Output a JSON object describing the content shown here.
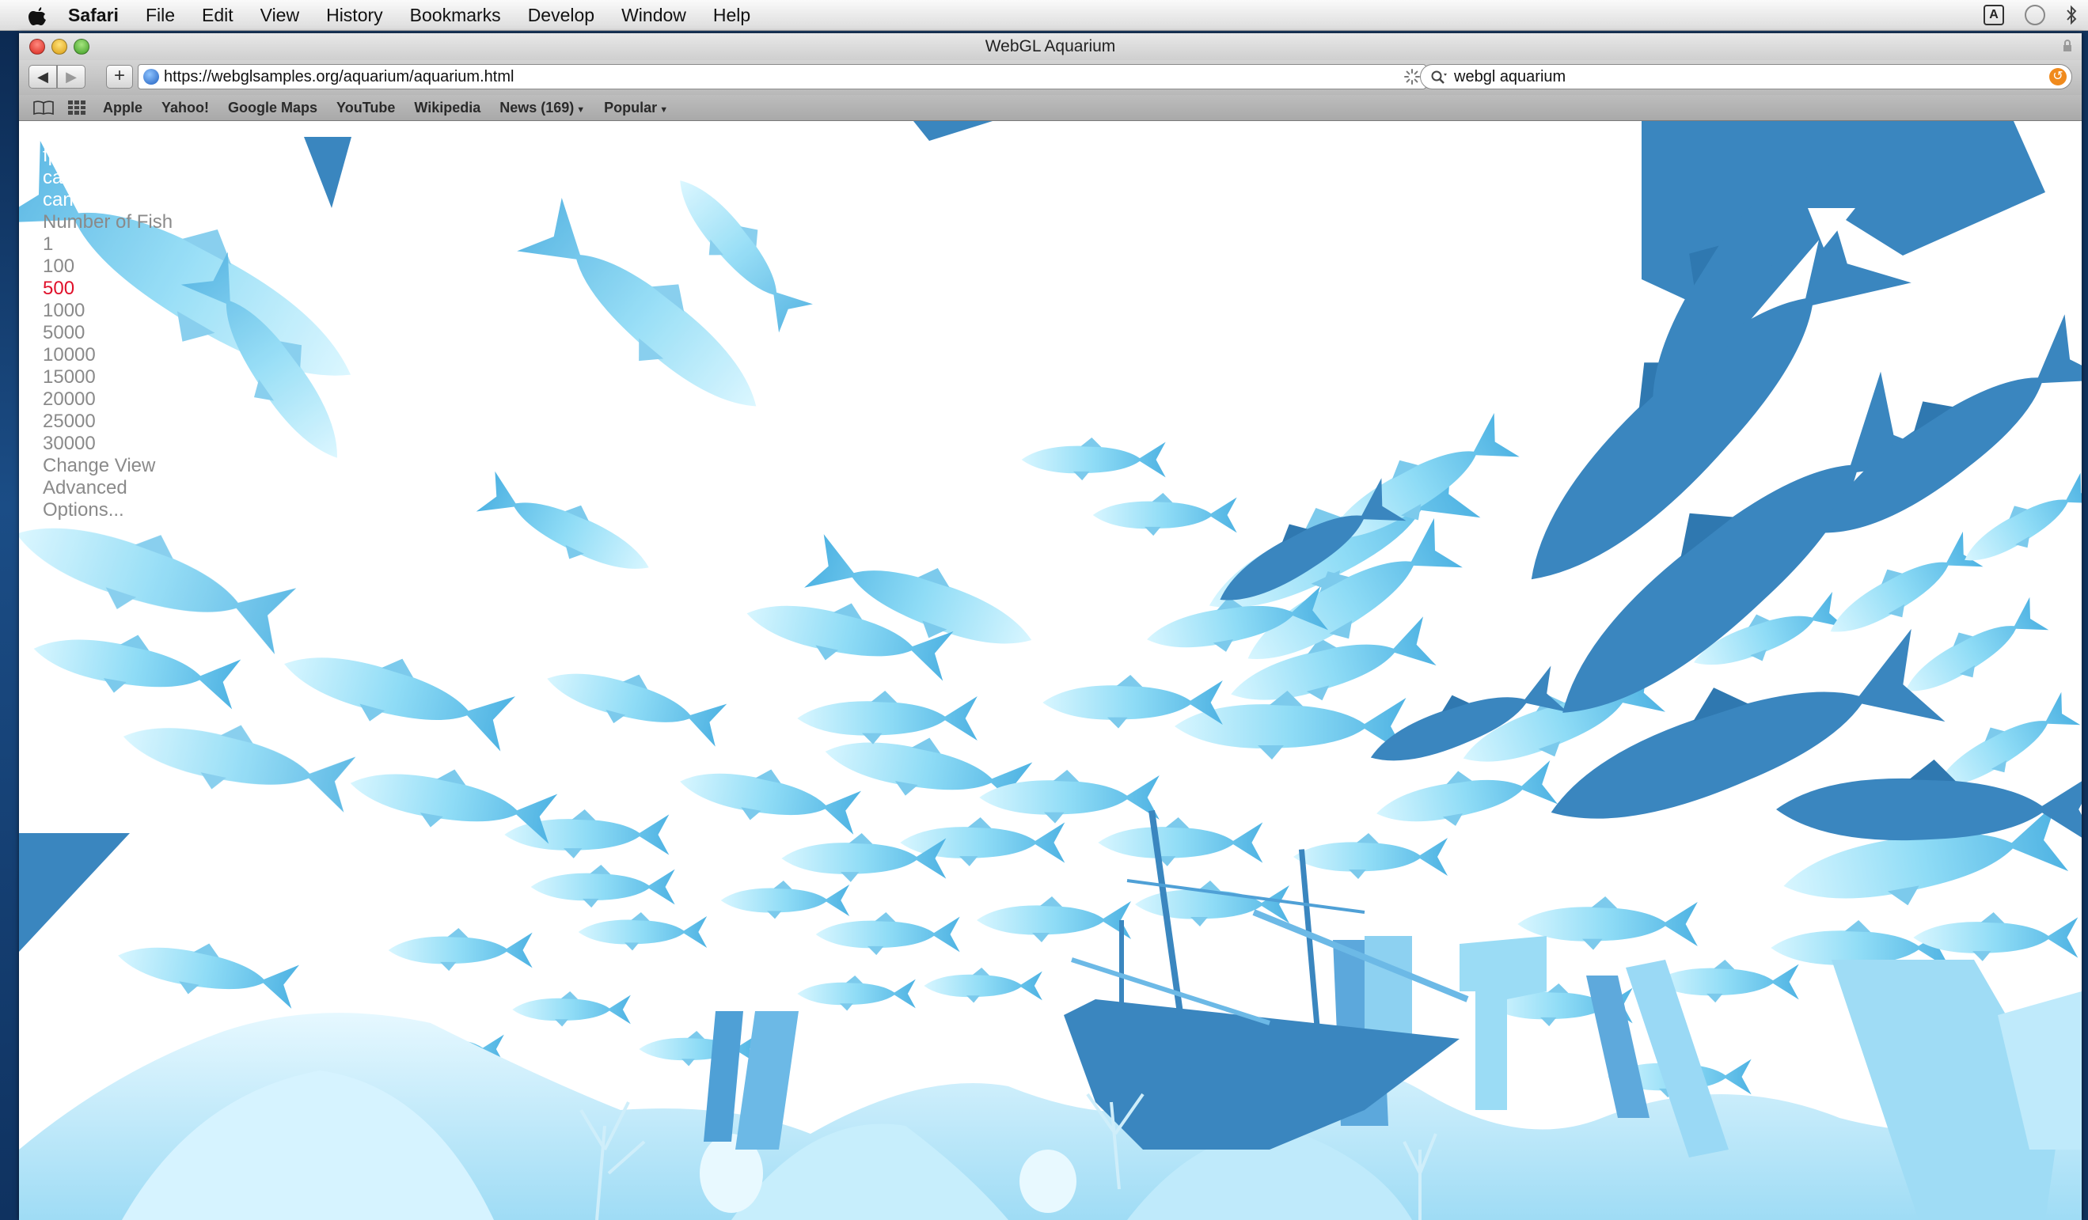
{
  "menubar": {
    "app": "Safari",
    "items": [
      "File",
      "Edit",
      "View",
      "History",
      "Bookmarks",
      "Develop",
      "Window",
      "Help"
    ]
  },
  "window": {
    "title": "WebGL Aquarium"
  },
  "toolbar": {
    "url": "https://webglsamples.org/aquarium/aquarium.html",
    "search_query": "webgl aquarium"
  },
  "bookmarks": {
    "items": [
      "Apple",
      "Yahoo!",
      "Google Maps",
      "YouTube",
      "Wikipedia",
      "News (169)",
      "Popular"
    ]
  },
  "hud": {
    "fps": "fps: 26",
    "canvas_line_1": "canvas",
    "canvas_line_2": "canvas",
    "number_of_fish_label": "Number of Fish",
    "fish_counts": [
      "1",
      "100",
      "500",
      "1000",
      "5000",
      "10000",
      "15000",
      "20000",
      "25000",
      "30000"
    ],
    "selected_fish_count": "500",
    "change_view": "Change View",
    "advanced": "Advanced",
    "options": "Options..."
  },
  "colors": {
    "fish_light": "#aee9fb",
    "fish_mid": "#6cc9ee",
    "fish_dark": "#3a86bf",
    "selected_option": "#e0102a"
  }
}
